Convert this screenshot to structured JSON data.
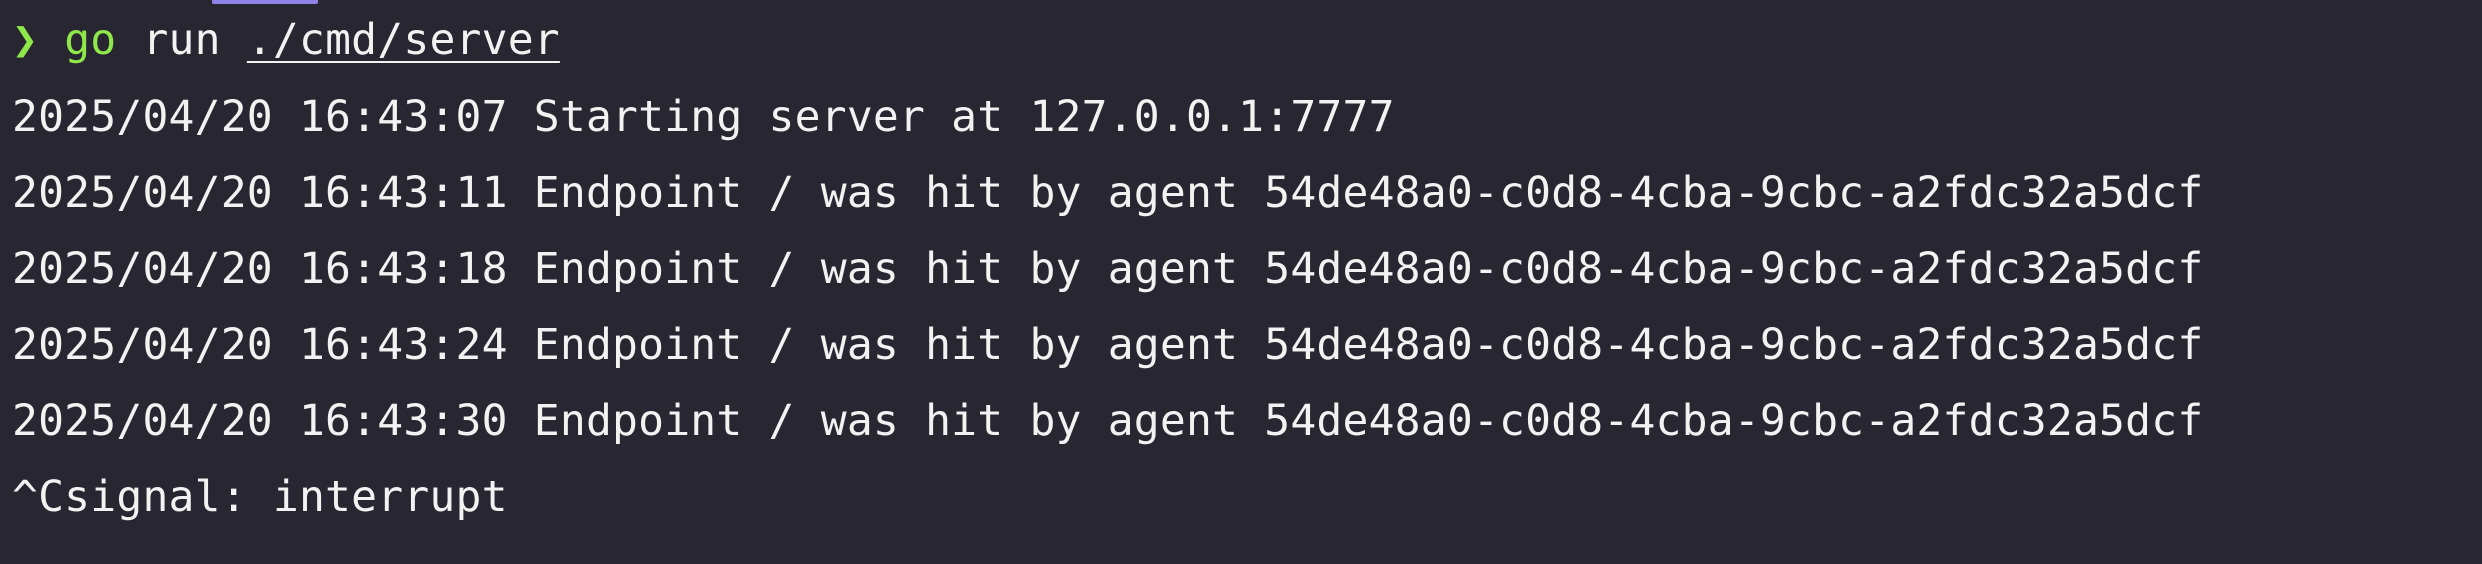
{
  "terminal": {
    "prompt_symbol": "❯",
    "command": {
      "program": "go",
      "subcommand": "run",
      "path": "./cmd/server"
    },
    "output_lines": [
      "2025/04/20 16:43:07 Starting server at 127.0.0.1:7777",
      "2025/04/20 16:43:11 Endpoint / was hit by agent 54de48a0-c0d8-4cba-9cbc-a2fdc32a5dcf",
      "2025/04/20 16:43:18 Endpoint / was hit by agent 54de48a0-c0d8-4cba-9cbc-a2fdc32a5dcf",
      "2025/04/20 16:43:24 Endpoint / was hit by agent 54de48a0-c0d8-4cba-9cbc-a2fdc32a5dcf",
      "2025/04/20 16:43:30 Endpoint / was hit by agent 54de48a0-c0d8-4cba-9cbc-a2fdc32a5dcf",
      "^Csignal: interrupt"
    ],
    "colors": {
      "background": "#282631",
      "text": "#f2f2f2",
      "prompt": "#8ee84a",
      "tab_accent": "#8f82e6"
    }
  }
}
